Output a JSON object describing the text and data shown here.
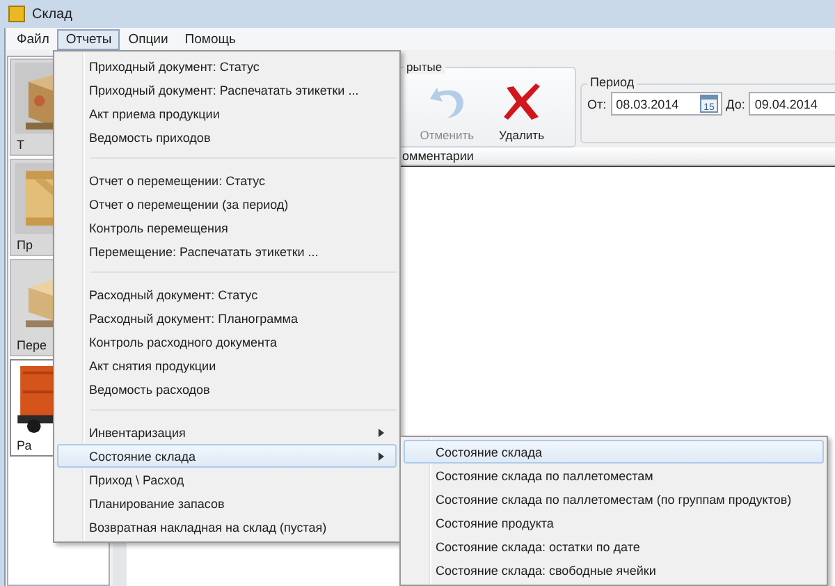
{
  "window": {
    "title": "Склад"
  },
  "menu_bar": [
    {
      "label": "Файл",
      "selected": false
    },
    {
      "label": "Отчеты",
      "selected": true
    },
    {
      "label": "Опции",
      "selected": false
    },
    {
      "label": "Помощь",
      "selected": false
    }
  ],
  "sidebar": {
    "items": [
      {
        "label": "Т",
        "selected": false,
        "kind": "box"
      },
      {
        "label": "Пр",
        "selected": false,
        "kind": "crate"
      },
      {
        "label": "Пере",
        "selected": false,
        "kind": "pallet"
      },
      {
        "label": "Ра",
        "selected": true,
        "kind": "truck"
      }
    ]
  },
  "toolbar": {
    "group_title": "рытые",
    "buttons": [
      {
        "label": "Отменить",
        "kind": "undo",
        "disabled": true
      },
      {
        "label": "Удалить",
        "kind": "delete",
        "disabled": false
      }
    ]
  },
  "period": {
    "title": "Период",
    "from_label": "От:",
    "from": "08.03.2014",
    "calendar_day": "15",
    "to_label": "До:",
    "to": "09.04.2014"
  },
  "table": {
    "columns": [
      "омментарии"
    ]
  },
  "menu": {
    "groups": [
      [
        {
          "label": "Приходный документ: Статус",
          "has_submenu": false,
          "selected": false
        },
        {
          "label": "Приходный документ: Распечатать этикетки ...",
          "has_submenu": false,
          "selected": false
        },
        {
          "label": "Акт приема продукции",
          "has_submenu": false,
          "selected": false
        },
        {
          "label": "Ведомость приходов",
          "has_submenu": false,
          "selected": false
        }
      ],
      [
        {
          "label": "Отчет о перемещении: Статус",
          "has_submenu": false,
          "selected": false
        },
        {
          "label": "Отчет о перемещении (за период)",
          "has_submenu": false,
          "selected": false
        },
        {
          "label": "Контроль перемещения",
          "has_submenu": false,
          "selected": false
        },
        {
          "label": "Перемещение: Распечатать этикетки ...",
          "has_submenu": false,
          "selected": false
        }
      ],
      [
        {
          "label": "Расходный документ: Статус",
          "has_submenu": false,
          "selected": false
        },
        {
          "label": "Расходный документ: Планограмма",
          "has_submenu": false,
          "selected": false
        },
        {
          "label": "Контроль расходного документа",
          "has_submenu": false,
          "selected": false
        },
        {
          "label": "Акт снятия продукции",
          "has_submenu": false,
          "selected": false
        },
        {
          "label": "Ведомость расходов",
          "has_submenu": false,
          "selected": false
        }
      ],
      [
        {
          "label": "Инвентаризация",
          "has_submenu": true,
          "selected": false
        },
        {
          "label": "Состояние склада",
          "has_submenu": true,
          "selected": true
        },
        {
          "label": "Приход \\ Расход",
          "has_submenu": false,
          "selected": false
        },
        {
          "label": "Планирование запасов",
          "has_submenu": false,
          "selected": false
        },
        {
          "label": "Возвратная накладная на склад (пустая)",
          "has_submenu": false,
          "selected": false
        }
      ]
    ]
  },
  "submenu": {
    "items": [
      {
        "label": "Состояние склада",
        "selected": true
      },
      {
        "label": "Состояние склада по паллетоместам",
        "selected": false
      },
      {
        "label": "Состояние склада по паллетоместам (по группам продуктов)",
        "selected": false
      },
      {
        "label": "Состояние продукта",
        "selected": false
      },
      {
        "label": "Состояние склада: остатки по дате",
        "selected": false
      },
      {
        "label": "Состояние склада: свободные ячейки",
        "selected": false
      }
    ]
  }
}
